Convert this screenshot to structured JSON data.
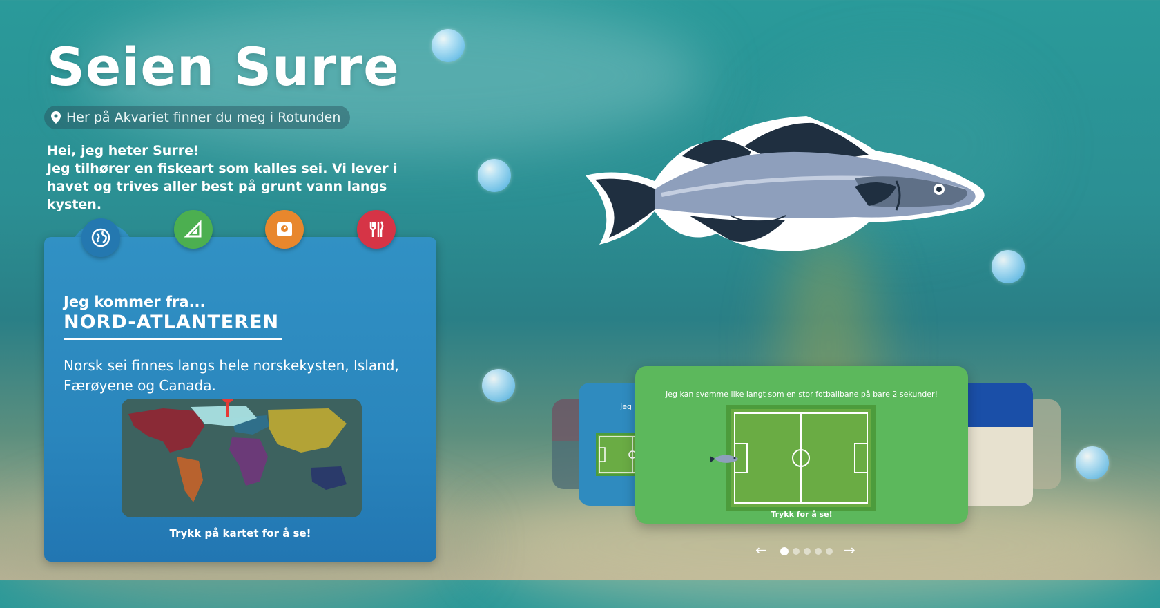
{
  "title": "Seien Surre",
  "location": {
    "text": "Her på Akvariet finner du meg i Rotunden",
    "icon": "location-pin-icon"
  },
  "intro": {
    "line1": "Hei, jeg heter Surre!",
    "line2": "Jeg tilhører en fiskeart som kalles sei. Vi lever i havet og trives aller best på grunt vann langs kysten."
  },
  "tabs": [
    {
      "icon": "globe-icon",
      "color": "#2b86bd"
    },
    {
      "icon": "ruler-icon",
      "color": "#4caf50"
    },
    {
      "icon": "scale-icon",
      "color": "#e8872d"
    },
    {
      "icon": "cutlery-icon",
      "color": "#d63446"
    }
  ],
  "panel": {
    "from_label": "Jeg kommer fra...",
    "region": "NORD-ATLANTEREN",
    "description": "Norsk sei finnes langs hele norskekysten, Island, Færøyene og Canada.",
    "map_hint": "Trykk på kartet for å se!"
  },
  "carousel": {
    "main_card": {
      "text": "Jeg kan svømme like langt som en stor fotballbane på bare 2 sekunder!",
      "hint": "Trykk for å se!",
      "color": "#5cb85c"
    },
    "back_card_text": "Jeg",
    "slide_count": 5,
    "active_index": 0,
    "prev_arrow": "←",
    "next_arrow": "→"
  }
}
